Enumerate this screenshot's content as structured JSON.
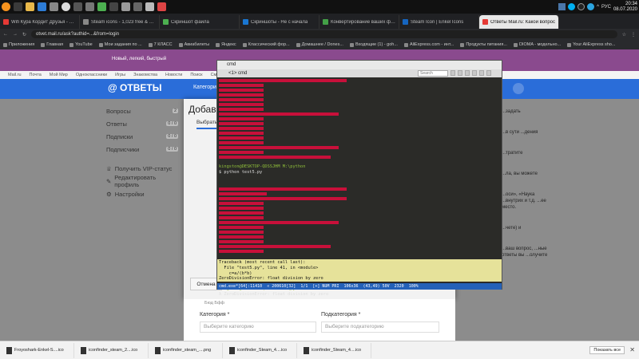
{
  "taskbar": {
    "lang": "РУС",
    "time": "20:34",
    "date": "08.07.2020"
  },
  "tabs": [
    {
      "label": "Wifi Кура Кордит Друзья - YouTube",
      "color": "#e53935"
    },
    {
      "label": "Steam icons - 1,023 free & premium",
      "color": "#888"
    },
    {
      "label": "Скриншот файла",
      "color": "#4caf50"
    },
    {
      "label": "Скриншоты - Не с начала",
      "color": "#1976d2"
    },
    {
      "label": "Конвертирование ваших файлов",
      "color": "#43a047"
    },
    {
      "label": "Steam Icon | Enkel Icons",
      "color": "#1565c0"
    },
    {
      "label": "Ответы Mail.ru: Какой вопрос",
      "color": "#e53935",
      "active": true
    }
  ],
  "address": {
    "url": "otvet.mail.ru/ask?authid=...&from=login"
  },
  "bookmarks": [
    "Приложения",
    "Главная",
    "YouTube",
    "Мои задания по ...",
    "7 КЛАСС",
    "Авиабилеты",
    "Яндекс",
    "Классический фор...",
    "Домашнее / Dones...",
    "Входящие (1) - goh...",
    "AliExpress.com - инт...",
    "Продукты питания...",
    "DIOMA - модельно...",
    "Your AliExpress sho..."
  ],
  "promo": {
    "text": "Новый, легкий, быстрый"
  },
  "mailnav": [
    "Mail.ru",
    "Почта",
    "Мой Мир",
    "Одноклассники",
    "Игры",
    "Знакомства",
    "Новости",
    "Поиск",
    "Смотри",
    "Combo"
  ],
  "header": {
    "logo": "@ ОТВЕТЫ",
    "categories": "Категории"
  },
  "sidebar": {
    "items": [
      {
        "label": "Вопросы",
        "count": "2"
      },
      {
        "label": "Ответы",
        "count": "0 / 0"
      },
      {
        "label": "Подписки",
        "count": "0 / 0"
      },
      {
        "label": "Подписчики",
        "count": "0 / 0"
      }
    ],
    "links": [
      "Получить VIP-статус",
      "Редактировать профиль",
      "Настройки"
    ]
  },
  "right_col": [
    "...задать",
    "...в сути ...дения",
    "...тратите",
    "...ла, вы можете",
    "...оси», «Наука ...внутрих и т.д. ...ее место.",
    "...чете) и",
    "...ваш вопрос, ...ные ответы вы ...олучите"
  ],
  "modal": {
    "title": "Добави",
    "tab": "Выбрать",
    "cancel": "Отмена",
    "small": "Бюд  Бфф",
    "category_label": "Категория *",
    "category_placeholder": "Выберите категорию",
    "subcategory_label": "Подкатегория *",
    "subcategory_placeholder": "Выберите подкатегорию"
  },
  "terminal": {
    "title": "cmd",
    "tab": "<1> cmd",
    "search": "Search",
    "prompt1": "kingston@DESKTOP-QDSSJHM M:\\python",
    "cmd1": "$ python test5.py",
    "traceback": [
      "Traceback (most recent call last):",
      "  File \"test5.py\", line 41, in <module>",
      "    c=a/(b*b)",
      "ZeroDivisionError: float division by zero"
    ],
    "prompt2": "kingston@DESKTOP-QDSSJHM M:\\python",
    "cmd2": "λ ZeroDivisionError: float division by zero",
    "status": [
      "cmd.exe*[64]:11410",
      "« 200610[32]",
      "1/1",
      "[+] NUM PRI",
      "106x36",
      "(43,49) 50V",
      "2320",
      "100%"
    ]
  },
  "downloads": {
    "items": [
      "Froyoshark-Enkel-S....ico",
      "iconfinder_steam_2....ico",
      "iconfinder_steam_....png",
      "iconfinder_Steam_4....ico",
      "iconfinder_Steam_4....ico"
    ],
    "show_all": "Показать все"
  }
}
